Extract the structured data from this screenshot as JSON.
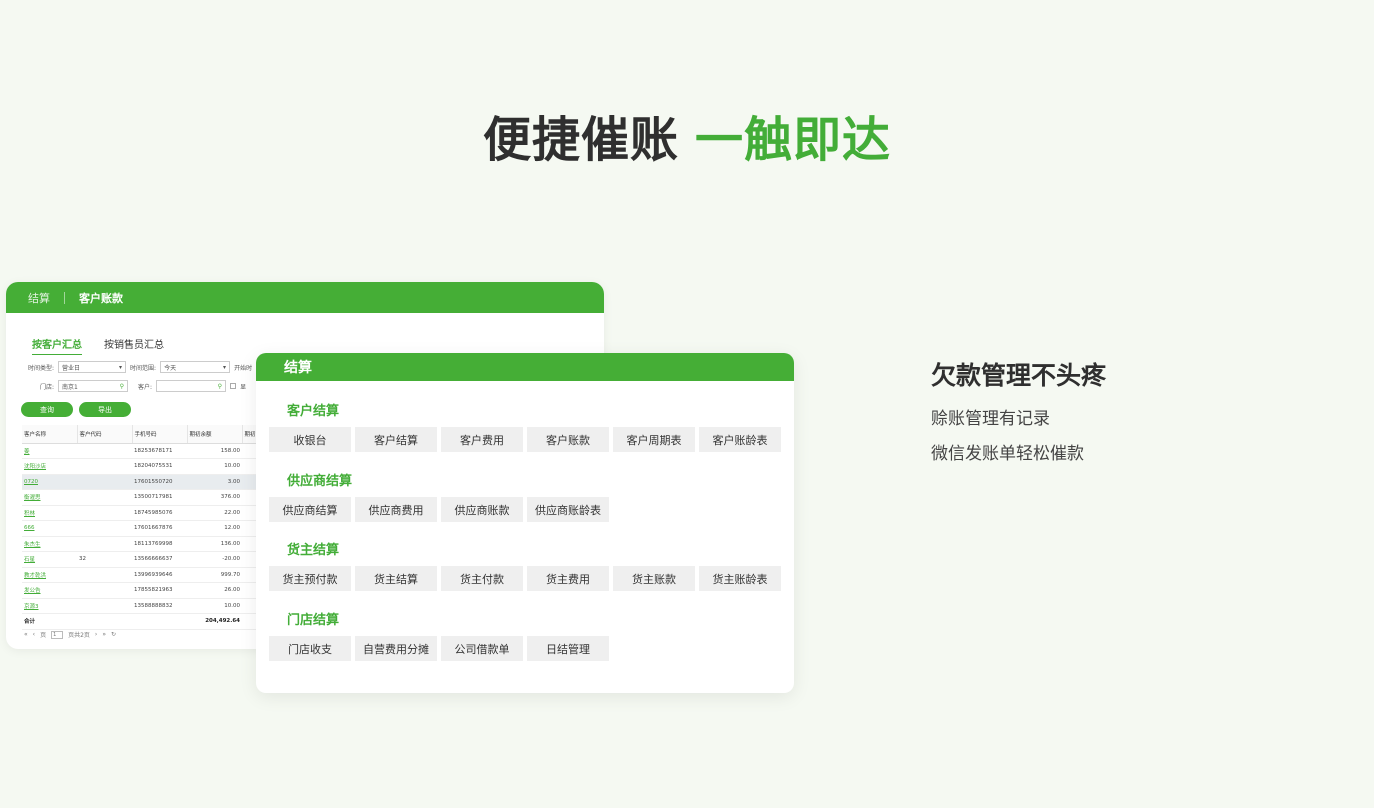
{
  "headline": {
    "dark": "便捷催账",
    "green": "一触即达"
  },
  "back_panel": {
    "crumb1": "结算",
    "crumb2": "客户账款",
    "tabs": [
      "按客户汇总",
      "按销售员汇总"
    ],
    "filters": {
      "time_type_label": "时间类型:",
      "time_type_value": "营业日",
      "time_range_label": "时间范围:",
      "time_range_value": "今天",
      "start_label": "开始时",
      "store_label": "门店:",
      "store_value": "南京1",
      "customer_label": "客户:",
      "checkbox_label": "显"
    },
    "buttons": {
      "query": "查询",
      "export": "导出"
    },
    "table": {
      "headers": [
        "客户名称",
        "客户代码",
        "手机号码",
        "期初余额",
        "期初"
      ],
      "rows": [
        {
          "name": "姜",
          "code": "",
          "phone": "18253678171",
          "balance": "158.00"
        },
        {
          "name": "沈阳沙店",
          "code": "",
          "phone": "18204075531",
          "balance": "10.00"
        },
        {
          "name": "0720",
          "code": "",
          "phone": "17601550720",
          "balance": "3.00"
        },
        {
          "name": "衡濯思",
          "code": "",
          "phone": "13500717981",
          "balance": "376.00"
        },
        {
          "name": "积林",
          "code": "",
          "phone": "18745985076",
          "balance": "22.00"
        },
        {
          "name": "666",
          "code": "",
          "phone": "17601667876",
          "balance": "12.00"
        },
        {
          "name": "朱杰生",
          "code": "",
          "phone": "18113769998",
          "balance": "136.00"
        },
        {
          "name": "石星",
          "code": "32",
          "phone": "13566666637",
          "balance": "-20.00"
        },
        {
          "name": "教才乾洪",
          "code": "",
          "phone": "13996939646",
          "balance": "999.70"
        },
        {
          "name": "发公告",
          "code": "",
          "phone": "17855821963",
          "balance": "26.00"
        },
        {
          "name": "京源3",
          "code": "",
          "phone": "13588888832",
          "balance": "10.00"
        }
      ],
      "total_label": "合计",
      "total_value": "204,492.64"
    },
    "pager": {
      "first": "«",
      "prev": "‹",
      "page_prefix": "页",
      "page_value": "1",
      "page_suffix": "页共2页",
      "next": "›",
      "last": "»",
      "refresh": "↻"
    }
  },
  "front_panel": {
    "title": "结算",
    "sections": [
      {
        "title": "客户结算",
        "buttons": [
          "收银台",
          "客户结算",
          "客户费用",
          "客户账款",
          "客户周期表",
          "客户账龄表"
        ]
      },
      {
        "title": "供应商结算",
        "buttons": [
          "供应商结算",
          "供应商费用",
          "供应商账款",
          "供应商账龄表"
        ]
      },
      {
        "title": "货主结算",
        "buttons": [
          "货主预付款",
          "货主结算",
          "货主付款",
          "货主费用",
          "货主账款",
          "货主账龄表"
        ]
      },
      {
        "title": "门店结算",
        "buttons": [
          "门店收支",
          "自营费用分摊",
          "公司借款单",
          "日结管理"
        ]
      }
    ]
  },
  "right_text": {
    "title": "欠款管理不头疼",
    "lines": [
      "赊账管理有记录",
      "微信发账单轻松催款"
    ]
  },
  "colors": {
    "accent": "#45ae36",
    "background": "#f5f9f2"
  }
}
